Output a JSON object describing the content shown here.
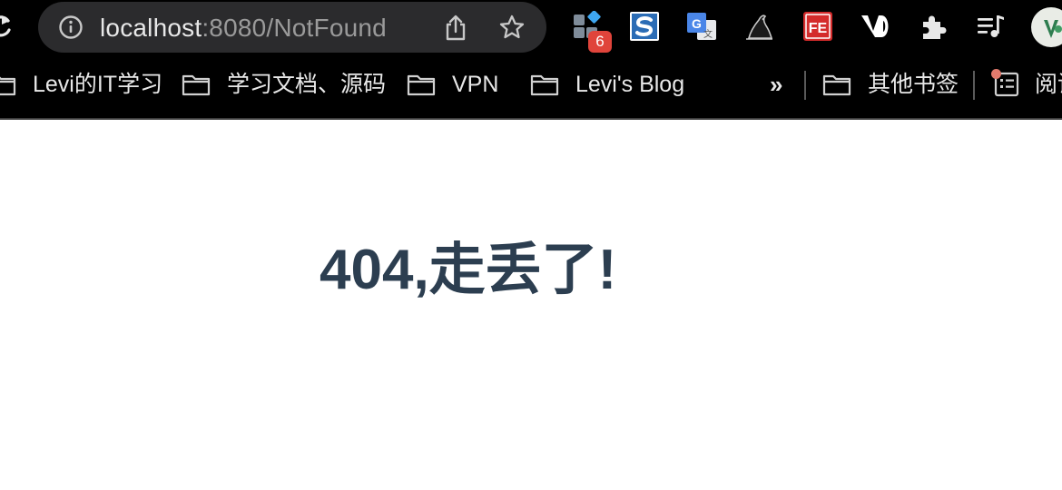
{
  "browser": {
    "address_bar": {
      "host": "localhost",
      "path": ":8080/NotFound"
    },
    "extensions": [
      {
        "icon": "tab-manager-icon",
        "badge": "6"
      },
      {
        "icon": "s-extension-icon"
      },
      {
        "icon": "google-translate-icon"
      },
      {
        "icon": "bird-extension-icon"
      },
      {
        "icon": "fe-extension-icon"
      },
      {
        "icon": "vd-extension-icon"
      },
      {
        "icon": "puzzle-icon"
      },
      {
        "icon": "media-control-icon"
      }
    ],
    "bookmarks": [
      {
        "label": "Levi的IT学习"
      },
      {
        "label": "学习文档、源码"
      },
      {
        "label": "VPN"
      },
      {
        "label": "Levi's Blog"
      }
    ],
    "overflow_label": "»",
    "other_bookmarks": "其他书签",
    "reading_list": "阅读"
  },
  "page": {
    "message": "404,走丢了!"
  },
  "colors": {
    "chrome_bg": "#000000",
    "omnibox_bg": "#2b2b2d",
    "heading_color": "#2c3e50",
    "badge_red": "#e0443b"
  }
}
